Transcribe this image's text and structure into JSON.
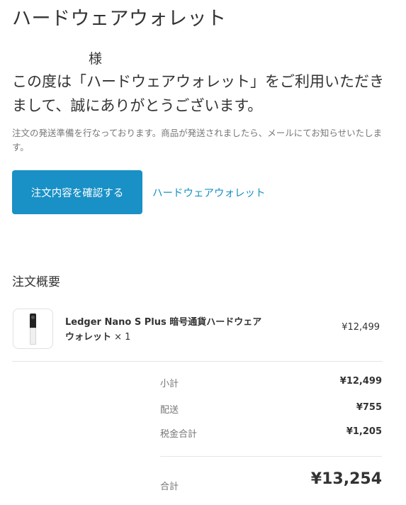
{
  "header": {
    "shop_name": "ハードウェアウォレット"
  },
  "greeting": {
    "customer_name": "様",
    "message": "この度は「ハードウェアウォレット」をご利用いただきまして、誠にありがとうございます。",
    "notice": "注文の発送準備を行なっております。商品が発送されましたら、メールにてお知らせいたします。"
  },
  "actions": {
    "view_order_label": "注文内容を確認する",
    "store_link_label": "ハードウェアウォレット"
  },
  "summary": {
    "title": "注文概要",
    "items": [
      {
        "name": "Ledger Nano S Plus 暗号通貨ハードウェアウォレット",
        "quantity": "× 1",
        "price": "¥12,499"
      }
    ],
    "subtotal_label": "小計",
    "subtotal_value": "¥12,499",
    "shipping_label": "配送",
    "shipping_value": "¥755",
    "tax_label": "税金合計",
    "tax_value": "¥1,205",
    "total_label": "合計",
    "total_value": "¥13,254"
  },
  "colors": {
    "accent": "#1990c6",
    "text": "#333333",
    "muted": "#777777",
    "divider": "#e5e5e5"
  }
}
